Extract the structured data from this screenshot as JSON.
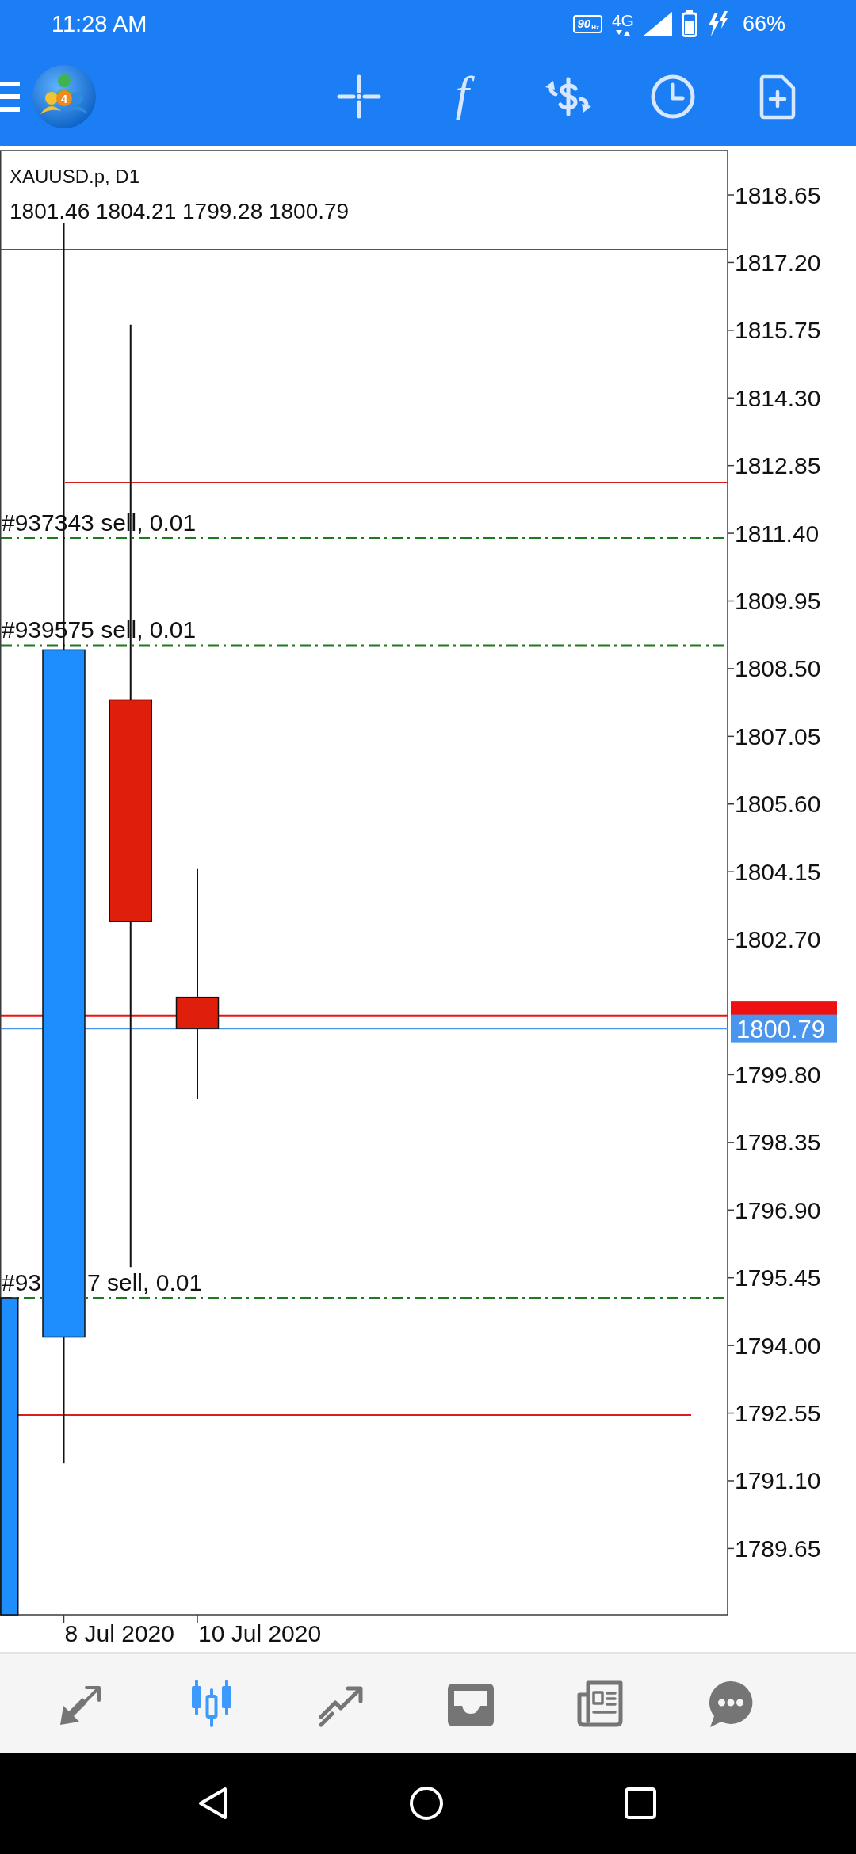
{
  "status_bar": {
    "time": "11:28 AM",
    "refresh_rate": {
      "value": "90",
      "unit": "Hz"
    },
    "network": "4G",
    "battery": "66%"
  },
  "toolbar": {
    "logo_badge": "4",
    "function_glyph": "f"
  },
  "chart": {
    "symbol": "XAUUSD.p, D1",
    "ohlc": "1801.46 1804.21 1799.28 1800.79",
    "price_axis": [
      "1818.65",
      "1817.20",
      "1815.75",
      "1814.30",
      "1812.85",
      "1811.40",
      "1809.95",
      "1808.50",
      "1807.05",
      "1805.60",
      "1804.15",
      "1802.70",
      "1799.80",
      "1798.35",
      "1796.90",
      "1795.45",
      "1794.00",
      "1792.55",
      "1791.10",
      "1789.65"
    ],
    "orders": [
      {
        "texts": [
          "#937343 sell, 0.01"
        ]
      },
      {
        "texts": [
          "#939575 sell, 0.01"
        ]
      },
      {
        "texts": [
          "#93",
          "7 sell, 0.01"
        ]
      }
    ],
    "bid_price": "1800.79",
    "dates": [
      "8 Jul 2020",
      "10 Jul 2020"
    ]
  },
  "bottom_nav": {
    "tabs": [
      {
        "selected": false
      },
      {
        "selected": true
      },
      {
        "selected": false
      },
      {
        "selected": false
      },
      {
        "selected": false
      },
      {
        "selected": false
      }
    ]
  }
}
